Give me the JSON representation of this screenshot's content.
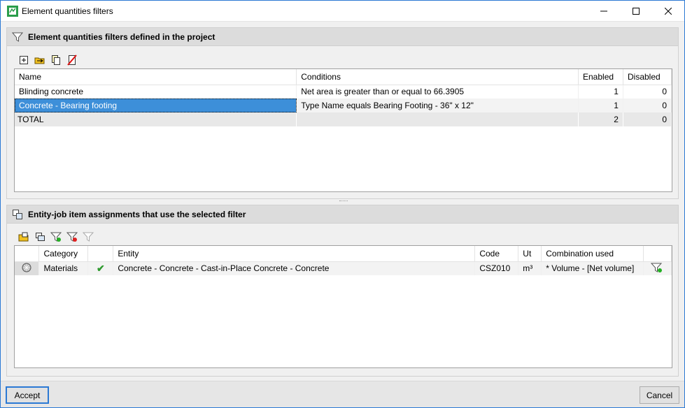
{
  "window": {
    "title": "Element quantities filters"
  },
  "section1": {
    "title": "Element quantities filters defined in the project",
    "toolbar": [
      "add-icon",
      "edit-icon",
      "copy-icon",
      "delete-icon"
    ],
    "columns": [
      "Name",
      "Conditions",
      "Enabled",
      "Disabled"
    ],
    "rows": [
      {
        "name": "Blinding concrete",
        "conditions": "Net area is greater than or equal to 66.3905",
        "enabled": "1",
        "disabled": "0"
      },
      {
        "name": "Concrete - Bearing footing",
        "conditions": "Type Name equals Bearing Footing - 36\" x 12\"",
        "enabled": "1",
        "disabled": "0",
        "selected": true
      }
    ],
    "total": {
      "label": "TOTAL",
      "enabled": "2",
      "disabled": "0"
    }
  },
  "section2": {
    "title": "Entity-job item assignments that use the selected filter",
    "toolbar": [
      "open-folder-icon",
      "assign-icon",
      "filter-enable-icon",
      "filter-disable-icon",
      "filter-clear-icon"
    ],
    "columns": [
      "",
      "Category",
      "",
      "Entity",
      "Code",
      "Ut",
      "Combination used",
      ""
    ],
    "rows": [
      {
        "category": "Materials",
        "entity": "Concrete - Concrete - Cast-in-Place Concrete - Concrete",
        "code": "CSZ010",
        "ut": "m³",
        "combination": "* Volume - [Net volume]"
      }
    ]
  },
  "footer": {
    "accept": "Accept",
    "cancel": "Cancel"
  },
  "colors": {
    "selection": "#3d8fd9",
    "accent": "#2b79d4",
    "check": "#2e9a2e"
  }
}
